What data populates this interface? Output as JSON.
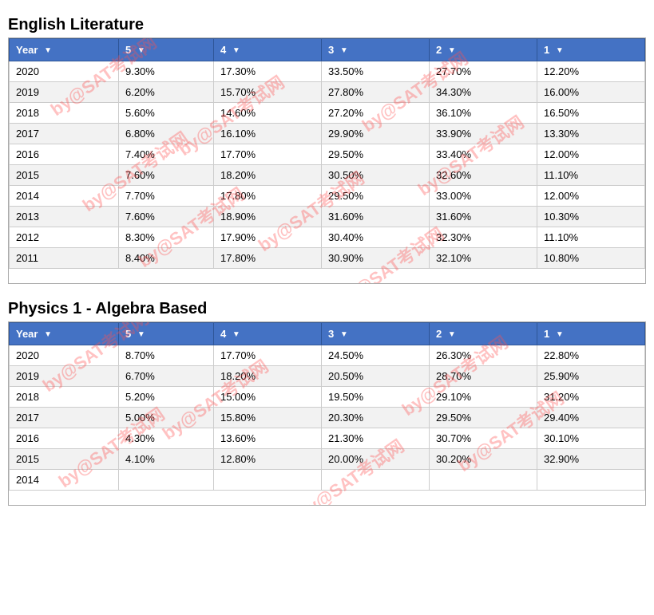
{
  "english_literature": {
    "title": "English Literature",
    "headers": [
      {
        "label": "Year",
        "key": "year"
      },
      {
        "label": "5",
        "key": "5"
      },
      {
        "label": "4",
        "key": "4"
      },
      {
        "label": "3",
        "key": "3"
      },
      {
        "label": "2",
        "key": "2"
      },
      {
        "label": "1",
        "key": "1"
      }
    ],
    "rows": [
      {
        "year": "2020",
        "5": "9.30%",
        "4": "17.30%",
        "3": "33.50%",
        "2": "27.70%",
        "1": "12.20%"
      },
      {
        "year": "2019",
        "5": "6.20%",
        "4": "15.70%",
        "3": "27.80%",
        "2": "34.30%",
        "1": "16.00%"
      },
      {
        "year": "2018",
        "5": "5.60%",
        "4": "14.60%",
        "3": "27.20%",
        "2": "36.10%",
        "1": "16.50%"
      },
      {
        "year": "2017",
        "5": "6.80%",
        "4": "16.10%",
        "3": "29.90%",
        "2": "33.90%",
        "1": "13.30%"
      },
      {
        "year": "2016",
        "5": "7.40%",
        "4": "17.70%",
        "3": "29.50%",
        "2": "33.40%",
        "1": "12.00%"
      },
      {
        "year": "2015",
        "5": "7.60%",
        "4": "18.20%",
        "3": "30.50%",
        "2": "32.60%",
        "1": "11.10%"
      },
      {
        "year": "2014",
        "5": "7.70%",
        "4": "17.80%",
        "3": "29.50%",
        "2": "33.00%",
        "1": "12.00%"
      },
      {
        "year": "2013",
        "5": "7.60%",
        "4": "18.90%",
        "3": "31.60%",
        "2": "31.60%",
        "1": "10.30%"
      },
      {
        "year": "2012",
        "5": "8.30%",
        "4": "17.90%",
        "3": "30.40%",
        "2": "32.30%",
        "1": "11.10%"
      },
      {
        "year": "2011",
        "5": "8.40%",
        "4": "17.80%",
        "3": "30.90%",
        "2": "32.10%",
        "1": "10.80%"
      }
    ]
  },
  "physics": {
    "title": "Physics 1 - Algebra Based",
    "headers": [
      {
        "label": "Year",
        "key": "year"
      },
      {
        "label": "5",
        "key": "5"
      },
      {
        "label": "4",
        "key": "4"
      },
      {
        "label": "3",
        "key": "3"
      },
      {
        "label": "2",
        "key": "2"
      },
      {
        "label": "1",
        "key": "1"
      }
    ],
    "rows": [
      {
        "year": "2020",
        "5": "8.70%",
        "4": "17.70%",
        "3": "24.50%",
        "2": "26.30%",
        "1": "22.80%"
      },
      {
        "year": "2019",
        "5": "6.70%",
        "4": "18.20%",
        "3": "20.50%",
        "2": "28.70%",
        "1": "25.90%"
      },
      {
        "year": "2018",
        "5": "5.20%",
        "4": "15.00%",
        "3": "19.50%",
        "2": "29.10%",
        "1": "31.20%"
      },
      {
        "year": "2017",
        "5": "5.00%",
        "4": "15.80%",
        "3": "20.30%",
        "2": "29.50%",
        "1": "29.40%"
      },
      {
        "year": "2016",
        "5": "4.30%",
        "4": "13.60%",
        "3": "21.30%",
        "2": "30.70%",
        "1": "30.10%"
      },
      {
        "year": "2015",
        "5": "4.10%",
        "4": "12.80%",
        "3": "20.00%",
        "2": "30.20%",
        "1": "32.90%"
      },
      {
        "year": "2014",
        "5": "",
        "4": "",
        "3": "",
        "2": "",
        "1": ""
      }
    ]
  },
  "watermark_texts": {
    "line1": "by@SAT考试网",
    "line2": "by@SAT考试网"
  }
}
